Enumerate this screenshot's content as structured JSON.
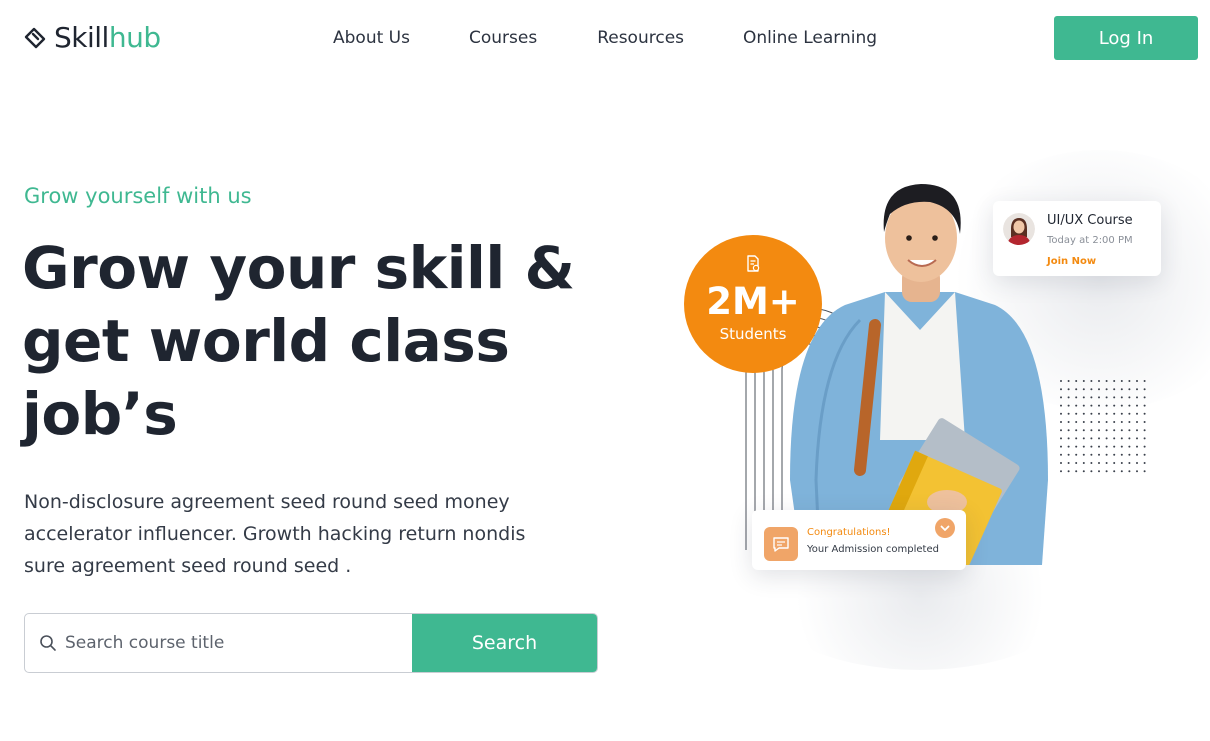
{
  "brand": {
    "name_part1": "Skill",
    "name_part2": "hub"
  },
  "nav": {
    "items": [
      {
        "label": "About Us"
      },
      {
        "label": "Courses"
      },
      {
        "label": "Resources"
      },
      {
        "label": "Online Learning"
      }
    ],
    "login_label": "Log In"
  },
  "hero": {
    "eyebrow": "Grow yourself with us",
    "headline_line1": "Grow your skill &",
    "headline_line2": "get world class",
    "headline_line3": "job’s",
    "description": "Non-disclosure agreement seed round seed money accelerator influencer. Growth hacking return nondis sure agreement seed round seed ."
  },
  "search": {
    "placeholder": "Search course title",
    "value": "",
    "button_label": "Search"
  },
  "stats_badge": {
    "value": "2M+",
    "label": "Students"
  },
  "course_card": {
    "title": "UI/UX Course",
    "time": "Today at 2:00 PM",
    "action": "Join Now"
  },
  "congrats_card": {
    "title": "Congratulations!",
    "subtitle": "Your Admission completed"
  },
  "colors": {
    "brand_green": "#3fb891",
    "accent_orange": "#f38a10",
    "text_dark": "#1f2530"
  },
  "icons": [
    "skillhub-logo-icon",
    "search-icon",
    "certificate-icon",
    "chat-icon",
    "chevron-down-icon"
  ]
}
